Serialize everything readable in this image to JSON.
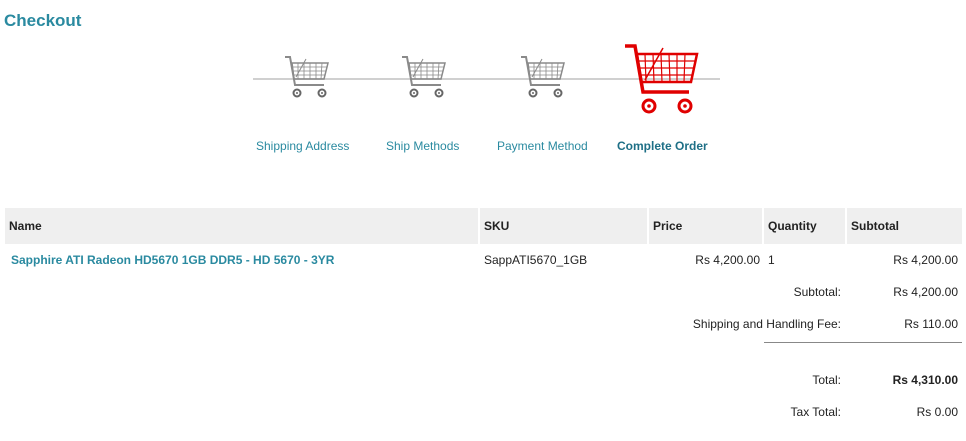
{
  "page": {
    "title": "Checkout"
  },
  "steps": [
    {
      "label": "Shipping Address",
      "current": false
    },
    {
      "label": "Ship Methods",
      "current": false
    },
    {
      "label": "Payment Method",
      "current": false
    },
    {
      "label": "Complete Order",
      "current": true
    }
  ],
  "colors": {
    "accent": "#2a8aa0",
    "cart_inactive": "#8a8a8a",
    "cart_active": "#e00000",
    "header_bg": "#efefef"
  },
  "table": {
    "headers": {
      "name": "Name",
      "sku": "SKU",
      "price": "Price",
      "quantity": "Quantity",
      "subtotal": "Subtotal"
    },
    "rows": [
      {
        "name": "Sapphire ATI Radeon HD5670 1GB DDR5 - HD 5670 - 3YR",
        "sku": "SappATI5670_1GB",
        "price": "Rs 4,200.00",
        "quantity": "1",
        "subtotal": "Rs 4,200.00"
      }
    ]
  },
  "summary": {
    "subtotal_label": "Subtotal:",
    "subtotal_value": "Rs 4,200.00",
    "shipping_label": "Shipping and Handling Fee:",
    "shipping_value": "Rs 110.00",
    "total_label": "Total:",
    "total_value": "Rs 4,310.00",
    "tax_label": "Tax Total:",
    "tax_value": "Rs 0.00"
  }
}
